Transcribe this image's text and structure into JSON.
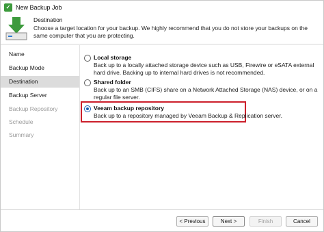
{
  "window": {
    "title": "New Backup Job",
    "app_icon": "veeam-icon"
  },
  "header": {
    "title": "Destination",
    "description": "Choose a target location for your backup. We highly recommend that you do not store your backups on the same computer that you are protecting.",
    "icon": "download-to-drive-icon"
  },
  "sidebar": {
    "items": [
      {
        "label": "Name",
        "state": "normal"
      },
      {
        "label": "Backup Mode",
        "state": "normal"
      },
      {
        "label": "Destination",
        "state": "selected"
      },
      {
        "label": "Backup Server",
        "state": "normal"
      },
      {
        "label": "Backup Repository",
        "state": "disabled"
      },
      {
        "label": "Schedule",
        "state": "disabled"
      },
      {
        "label": "Summary",
        "state": "disabled"
      }
    ]
  },
  "options": [
    {
      "title": "Local storage",
      "description": "Back up to a locally attached storage device such as USB, Firewire or eSATA external hard drive. Backing up to internal hard drives is not recommended.",
      "checked": false
    },
    {
      "title": "Shared folder",
      "description": "Back up to an SMB (CIFS) share on a Network Attached Storage (NAS) device, or on a regular file server.",
      "checked": false
    },
    {
      "title": "Veeam backup repository",
      "description": "Back up to a repository managed by Veeam Backup & Replication server.",
      "checked": true
    }
  ],
  "footer": {
    "previous_label": "< Previous",
    "next_label": "Next >",
    "finish_label": "Finish",
    "cancel_label": "Cancel"
  },
  "colors": {
    "highlight": "#cc1f2b",
    "selected_nav": "#dcdcdc",
    "radio_accent": "#1a5fb4"
  }
}
